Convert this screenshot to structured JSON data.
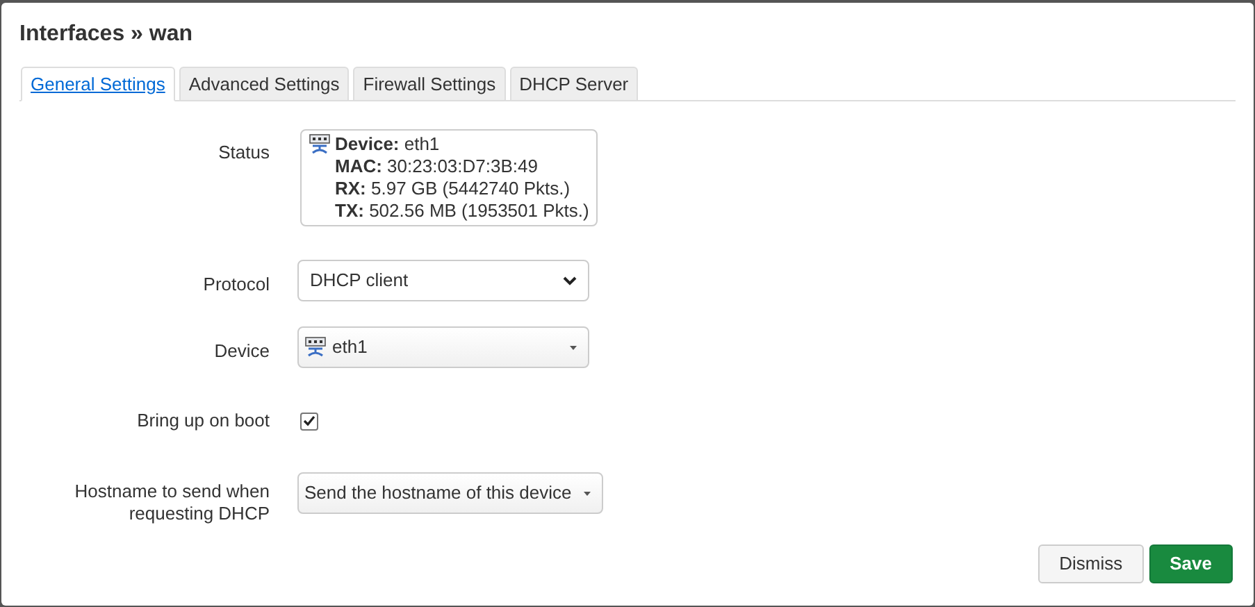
{
  "dialog": {
    "title": "Interfaces » wan"
  },
  "tabs": [
    {
      "label": "General Settings",
      "selected": true
    },
    {
      "label": "Advanced Settings",
      "selected": false
    },
    {
      "label": "Firewall Settings",
      "selected": false
    },
    {
      "label": "DHCP Server",
      "selected": false
    }
  ],
  "fields": [
    {
      "kind": "status",
      "label": "Status",
      "lines": [
        "**Device:** eth1",
        "**MAC:** 30:23:03:D7:3B:49",
        "**RX:** 5.97 GB (5442740 Pkts.)",
        "**TX:** 502.56 MB (1953501 Pkts.)"
      ]
    },
    {
      "kind": "select",
      "label": "Protocol",
      "value": "DHCP client"
    },
    {
      "kind": "device",
      "label": "Device",
      "value": "eth1"
    },
    {
      "kind": "checkbox",
      "label": "Bring up on boot",
      "checked": true
    },
    {
      "kind": "dropdown",
      "label": "Hostname to send when requesting DHCP",
      "value": "Send the hostname of this device"
    }
  ],
  "buttons": [
    {
      "label": "Dismiss",
      "kind": "secondary"
    },
    {
      "label": "Save",
      "kind": "primary"
    }
  ]
}
